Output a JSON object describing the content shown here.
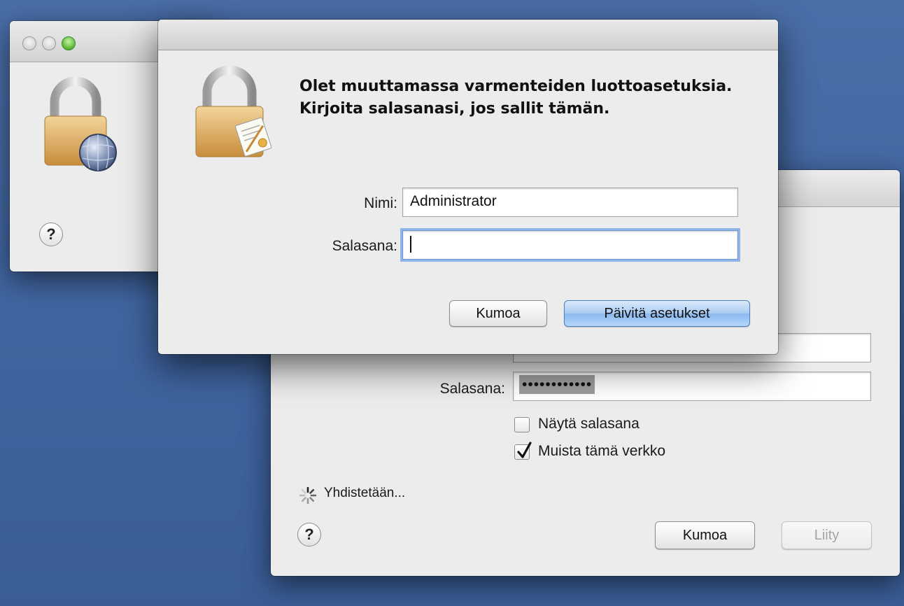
{
  "left_window": {
    "help_label": "?"
  },
  "right_window": {
    "password_label": "Salasana:",
    "password_value": "••••••••••••",
    "show_password_label": "Näytä salasana",
    "show_password_checked": false,
    "remember_network_label": "Muista tämä verkko",
    "remember_network_checked": true,
    "status_text": "Yhdistetään...",
    "help_label": "?",
    "cancel_label": "Kumoa",
    "join_label": "Liity"
  },
  "auth_dialog": {
    "message": "Olet muuttamassa varmenteiden luottoasetuksia. Kirjoita salasanasi, jos sallit tämän.",
    "name_label": "Nimi:",
    "name_value": "Administrator",
    "password_label": "Salasana:",
    "password_value": "",
    "cancel_label": "Kumoa",
    "confirm_label": "Päivitä asetukset"
  },
  "icons": [
    "lock-globe-icon",
    "lock-certificate-icon",
    "spinner-icon",
    "checkmark-icon"
  ],
  "colors": {
    "desktop": "#4065a0",
    "default_button": "#9cc4f2",
    "focus_ring": "#8fb6e6"
  }
}
